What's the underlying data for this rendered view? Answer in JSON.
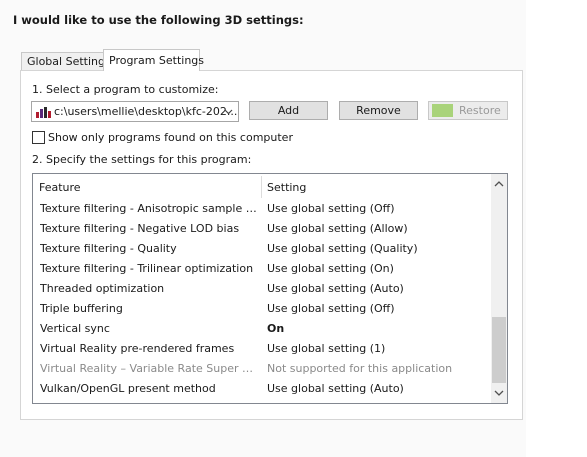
{
  "heading": "I would like to use the following 3D settings:",
  "tabs": [
    {
      "label": "Global Settings",
      "active": false
    },
    {
      "label": "Program Settings",
      "active": true
    }
  ],
  "select_program_label": "1. Select a program to customize:",
  "program_select": {
    "value": "c:\\users\\mellie\\desktop\\kfc-202...",
    "icon": "program-app-icon"
  },
  "buttons": {
    "add": "Add",
    "remove": "Remove",
    "restore": "Restore"
  },
  "show_only_label": "Show only programs found on this computer",
  "show_only_checked": false,
  "specify_label": "2. Specify the settings for this program:",
  "table": {
    "headers": {
      "feature": "Feature",
      "setting": "Setting"
    },
    "rows": [
      {
        "feature": "Texture filtering - Anisotropic sample opti...",
        "setting": "Use global setting (Off)"
      },
      {
        "feature": "Texture filtering - Negative LOD bias",
        "setting": "Use global setting (Allow)"
      },
      {
        "feature": "Texture filtering - Quality",
        "setting": "Use global setting (Quality)"
      },
      {
        "feature": "Texture filtering - Trilinear optimization",
        "setting": "Use global setting (On)"
      },
      {
        "feature": "Threaded optimization",
        "setting": "Use global setting (Auto)"
      },
      {
        "feature": "Triple buffering",
        "setting": "Use global setting (Off)"
      },
      {
        "feature": "Vertical sync",
        "setting": "On"
      },
      {
        "feature": "Virtual Reality pre-rendered frames",
        "setting": "Use global setting (1)"
      },
      {
        "feature": "Virtual Reality – Variable Rate Super Samp...",
        "setting": "Not supported for this application"
      },
      {
        "feature": "Vulkan/OpenGL present method",
        "setting": "Use global setting (Auto)"
      }
    ]
  },
  "colors": {
    "nvidia_green": "#a9d37a",
    "disabled_text": "#8a8a8a"
  }
}
